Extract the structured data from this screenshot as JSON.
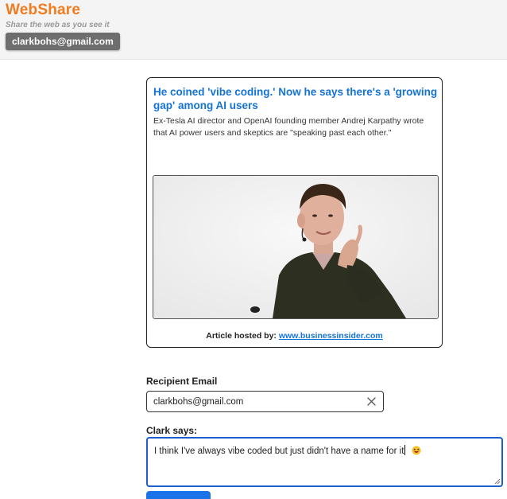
{
  "app": {
    "title": "WebShare",
    "tagline": "Share the web as you see it",
    "user_email": "clarkbohs@gmail.com"
  },
  "article": {
    "title": "He coined 'vibe coding.' Now he says there's a 'growing gap' among AI users",
    "description": "Ex-Tesla AI director and OpenAI founding member Andrej Karpathy wrote that AI power users and skeptics are \"speaking past each other.\"",
    "hosted_by_label": "Article hosted by:",
    "host": "www.businessinsider.com"
  },
  "form": {
    "recipient_label": "Recipient Email",
    "recipient_value": "clarkbohs@gmail.com",
    "comment_label": "Clark says:",
    "comment_value": "I think I've always vibe coded but just didn't have a name for it",
    "comment_emoji": "grinning-squinting-face"
  },
  "icons": {
    "clear": "close-icon",
    "resize": "resize-grip-icon"
  },
  "colors": {
    "brand": "#f07c1f",
    "link": "#1473d6",
    "focus": "#1b5fcf",
    "button": "#1a73e8",
    "badge": "#6e6e6e"
  }
}
